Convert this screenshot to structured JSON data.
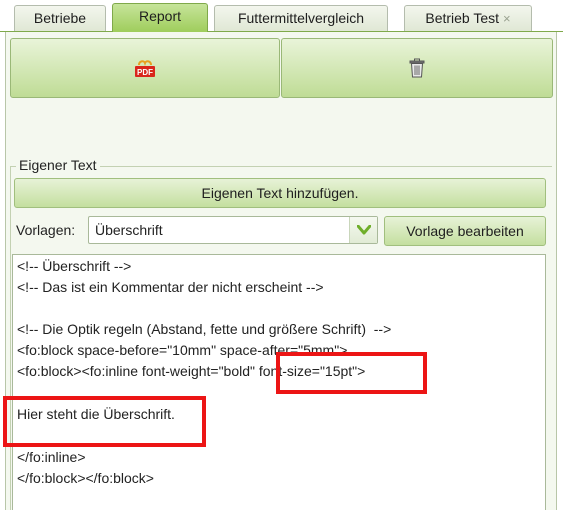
{
  "tabs": [
    {
      "label": "Betriebe",
      "active": false
    },
    {
      "label": "Report",
      "active": true
    },
    {
      "label": "Futtermittelvergleich",
      "active": false
    },
    {
      "label": "Betrieb Test",
      "active": false,
      "close": "×"
    }
  ],
  "toolbar": {
    "pdf_icon": "pdf-icon",
    "pdf_icon_text": "PDF",
    "delete_icon": "trash-icon"
  },
  "section": {
    "legend": "Eigener Text",
    "add_button": "Eigenen Text hinzufügen.",
    "templates_label": "Vorlagen:",
    "templates_selected": "Überschrift",
    "edit_template_button": "Vorlage bearbeiten"
  },
  "editor_lines": [
    "<!-- Überschrift -->",
    "<!-- Das ist ein Kommentar der nicht erscheint -->",
    "",
    "<!-- Die Optik regeln (Abstand, fette und größere Schrift)  -->",
    "<fo:block space-before=\"10mm\" space-after=\"5mm\">",
    "<fo:block><fo:inline font-weight=\"bold\" font-size=\"15pt\">",
    "",
    "Hier steht die Überschrift.",
    "",
    "</fo:inline>",
    "</fo:block></fo:block>"
  ],
  "colors": {
    "accent_green": "#9fcd5c",
    "highlight_red": "#ec1515"
  }
}
